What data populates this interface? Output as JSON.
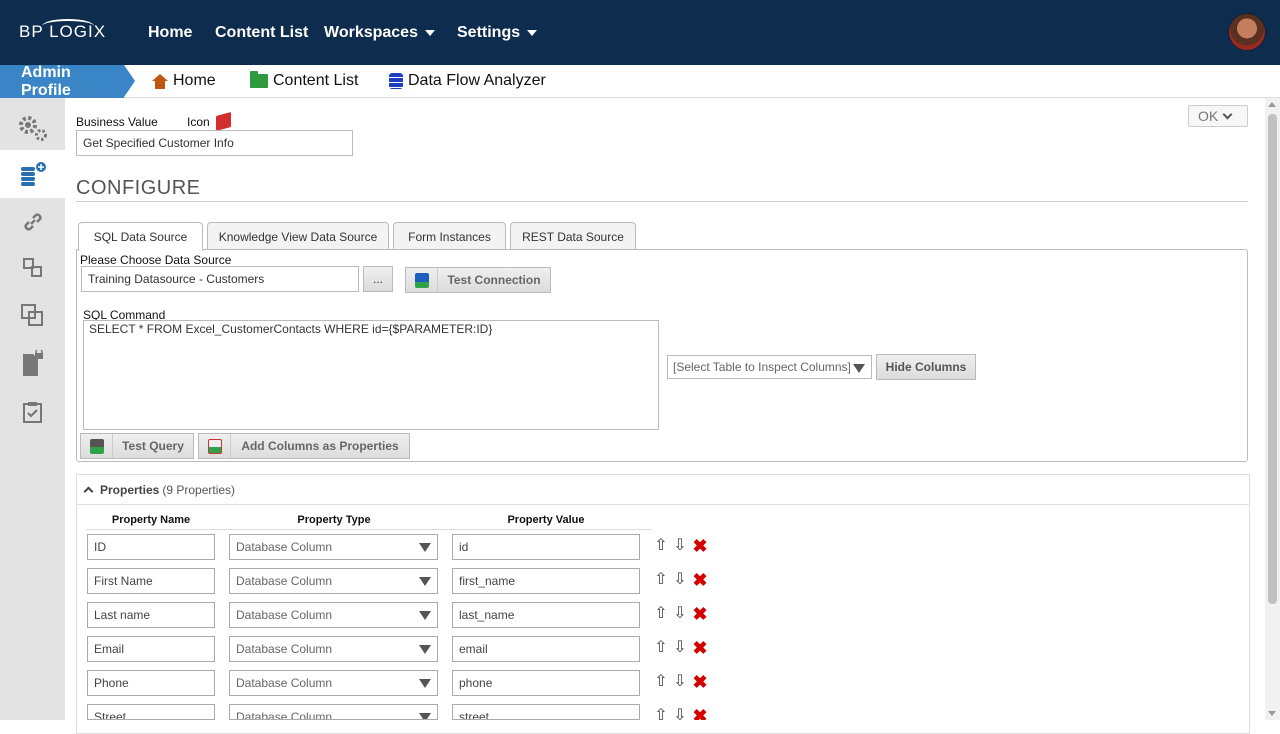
{
  "topnav": {
    "logo": "BP LOGIX",
    "items": [
      {
        "label": "Home",
        "has_dropdown": false
      },
      {
        "label": "Content List",
        "has_dropdown": false
      },
      {
        "label": "Workspaces",
        "has_dropdown": true
      },
      {
        "label": "Settings",
        "has_dropdown": true
      }
    ],
    "avatar_icon": "user-avatar"
  },
  "breadcrumb": {
    "current": "Admin Profile",
    "links": [
      {
        "label": "Home",
        "icon": "home-icon"
      },
      {
        "label": "Content List",
        "icon": "folder-icon"
      },
      {
        "label": "Data Flow Analyzer",
        "icon": "database-icon"
      }
    ]
  },
  "sidebar": {
    "items": [
      {
        "icon": "gears-icon",
        "active": false
      },
      {
        "icon": "database-add-icon",
        "active": true
      },
      {
        "icon": "link-icon",
        "active": false
      },
      {
        "icon": "connector-icon",
        "active": false
      },
      {
        "icon": "copy-icon",
        "active": false
      },
      {
        "icon": "lock-document-icon",
        "active": false
      },
      {
        "icon": "checklist-icon",
        "active": false
      }
    ]
  },
  "form": {
    "business_value_label": "Business Value",
    "icon_label": "Icon",
    "business_value": "Get Specified Customer Info",
    "ok_label": "OK",
    "section_title": "CONFIGURE"
  },
  "tabs": [
    {
      "label": "SQL Data Source",
      "active": true
    },
    {
      "label": "Knowledge View Data Source",
      "active": false
    },
    {
      "label": "Form Instances",
      "active": false
    },
    {
      "label": "REST Data Source",
      "active": false
    }
  ],
  "sql": {
    "datasource_label": "Please Choose Data Source",
    "datasource_value": "Training Datasource - Customers",
    "browse_label": "...",
    "test_connection_label": "Test Connection",
    "command_label": "SQL Command",
    "command_value": "SELECT * FROM Excel_CustomerContacts WHERE id={$PARAMETER:ID}",
    "inspect_placeholder": "[Select Table to Inspect Columns]",
    "hide_columns_label": "Hide Columns",
    "test_query_label": "Test Query",
    "add_columns_label": "Add Columns as Properties"
  },
  "properties": {
    "title": "Properties",
    "count_text": "(9 Properties)",
    "headers": [
      "Property Name",
      "Property Type",
      "Property Value"
    ],
    "rows": [
      {
        "name": "ID",
        "type": "Database Column",
        "value": "id"
      },
      {
        "name": "First Name",
        "type": "Database Column",
        "value": "first_name"
      },
      {
        "name": "Last name",
        "type": "Database Column",
        "value": "last_name"
      },
      {
        "name": "Email",
        "type": "Database Column",
        "value": "email"
      },
      {
        "name": "Phone",
        "type": "Database Column",
        "value": "phone"
      },
      {
        "name": "Street",
        "type": "Database Column",
        "value": "street"
      }
    ]
  },
  "colors": {
    "topnav_bg": "#0d2c4e",
    "accent_blue": "#3a85c5",
    "delete_red": "#d40000"
  }
}
